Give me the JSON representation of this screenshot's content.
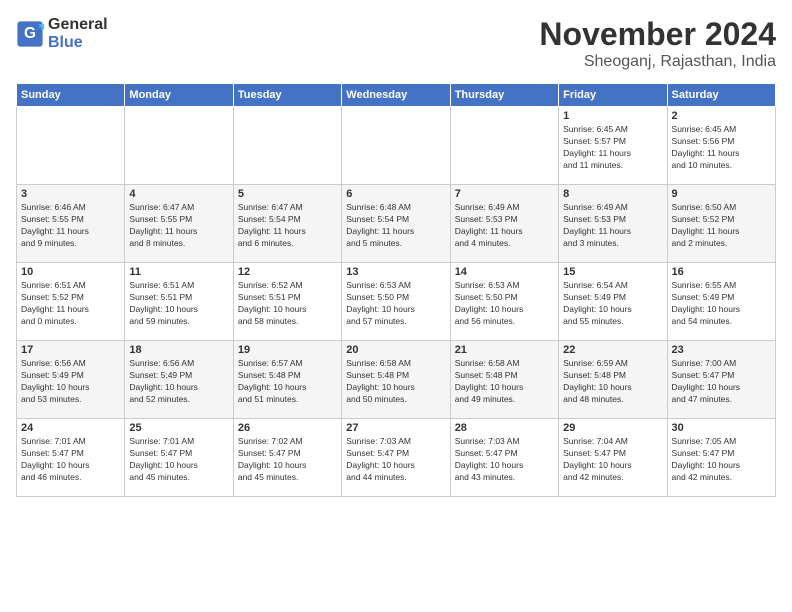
{
  "logo": {
    "line1": "General",
    "line2": "Blue"
  },
  "title": "November 2024",
  "subtitle": "Sheoganj, Rajasthan, India",
  "headers": [
    "Sunday",
    "Monday",
    "Tuesday",
    "Wednesday",
    "Thursday",
    "Friday",
    "Saturday"
  ],
  "rows": [
    [
      {
        "day": "",
        "content": ""
      },
      {
        "day": "",
        "content": ""
      },
      {
        "day": "",
        "content": ""
      },
      {
        "day": "",
        "content": ""
      },
      {
        "day": "",
        "content": ""
      },
      {
        "day": "1",
        "content": "Sunrise: 6:45 AM\nSunset: 5:57 PM\nDaylight: 11 hours\nand 11 minutes."
      },
      {
        "day": "2",
        "content": "Sunrise: 6:45 AM\nSunset: 5:56 PM\nDaylight: 11 hours\nand 10 minutes."
      }
    ],
    [
      {
        "day": "3",
        "content": "Sunrise: 6:46 AM\nSunset: 5:55 PM\nDaylight: 11 hours\nand 9 minutes."
      },
      {
        "day": "4",
        "content": "Sunrise: 6:47 AM\nSunset: 5:55 PM\nDaylight: 11 hours\nand 8 minutes."
      },
      {
        "day": "5",
        "content": "Sunrise: 6:47 AM\nSunset: 5:54 PM\nDaylight: 11 hours\nand 6 minutes."
      },
      {
        "day": "6",
        "content": "Sunrise: 6:48 AM\nSunset: 5:54 PM\nDaylight: 11 hours\nand 5 minutes."
      },
      {
        "day": "7",
        "content": "Sunrise: 6:49 AM\nSunset: 5:53 PM\nDaylight: 11 hours\nand 4 minutes."
      },
      {
        "day": "8",
        "content": "Sunrise: 6:49 AM\nSunset: 5:53 PM\nDaylight: 11 hours\nand 3 minutes."
      },
      {
        "day": "9",
        "content": "Sunrise: 6:50 AM\nSunset: 5:52 PM\nDaylight: 11 hours\nand 2 minutes."
      }
    ],
    [
      {
        "day": "10",
        "content": "Sunrise: 6:51 AM\nSunset: 5:52 PM\nDaylight: 11 hours\nand 0 minutes."
      },
      {
        "day": "11",
        "content": "Sunrise: 6:51 AM\nSunset: 5:51 PM\nDaylight: 10 hours\nand 59 minutes."
      },
      {
        "day": "12",
        "content": "Sunrise: 6:52 AM\nSunset: 5:51 PM\nDaylight: 10 hours\nand 58 minutes."
      },
      {
        "day": "13",
        "content": "Sunrise: 6:53 AM\nSunset: 5:50 PM\nDaylight: 10 hours\nand 57 minutes."
      },
      {
        "day": "14",
        "content": "Sunrise: 6:53 AM\nSunset: 5:50 PM\nDaylight: 10 hours\nand 56 minutes."
      },
      {
        "day": "15",
        "content": "Sunrise: 6:54 AM\nSunset: 5:49 PM\nDaylight: 10 hours\nand 55 minutes."
      },
      {
        "day": "16",
        "content": "Sunrise: 6:55 AM\nSunset: 5:49 PM\nDaylight: 10 hours\nand 54 minutes."
      }
    ],
    [
      {
        "day": "17",
        "content": "Sunrise: 6:56 AM\nSunset: 5:49 PM\nDaylight: 10 hours\nand 53 minutes."
      },
      {
        "day": "18",
        "content": "Sunrise: 6:56 AM\nSunset: 5:49 PM\nDaylight: 10 hours\nand 52 minutes."
      },
      {
        "day": "19",
        "content": "Sunrise: 6:57 AM\nSunset: 5:48 PM\nDaylight: 10 hours\nand 51 minutes."
      },
      {
        "day": "20",
        "content": "Sunrise: 6:58 AM\nSunset: 5:48 PM\nDaylight: 10 hours\nand 50 minutes."
      },
      {
        "day": "21",
        "content": "Sunrise: 6:58 AM\nSunset: 5:48 PM\nDaylight: 10 hours\nand 49 minutes."
      },
      {
        "day": "22",
        "content": "Sunrise: 6:59 AM\nSunset: 5:48 PM\nDaylight: 10 hours\nand 48 minutes."
      },
      {
        "day": "23",
        "content": "Sunrise: 7:00 AM\nSunset: 5:47 PM\nDaylight: 10 hours\nand 47 minutes."
      }
    ],
    [
      {
        "day": "24",
        "content": "Sunrise: 7:01 AM\nSunset: 5:47 PM\nDaylight: 10 hours\nand 46 minutes."
      },
      {
        "day": "25",
        "content": "Sunrise: 7:01 AM\nSunset: 5:47 PM\nDaylight: 10 hours\nand 45 minutes."
      },
      {
        "day": "26",
        "content": "Sunrise: 7:02 AM\nSunset: 5:47 PM\nDaylight: 10 hours\nand 45 minutes."
      },
      {
        "day": "27",
        "content": "Sunrise: 7:03 AM\nSunset: 5:47 PM\nDaylight: 10 hours\nand 44 minutes."
      },
      {
        "day": "28",
        "content": "Sunrise: 7:03 AM\nSunset: 5:47 PM\nDaylight: 10 hours\nand 43 minutes."
      },
      {
        "day": "29",
        "content": "Sunrise: 7:04 AM\nSunset: 5:47 PM\nDaylight: 10 hours\nand 42 minutes."
      },
      {
        "day": "30",
        "content": "Sunrise: 7:05 AM\nSunset: 5:47 PM\nDaylight: 10 hours\nand 42 minutes."
      }
    ]
  ]
}
